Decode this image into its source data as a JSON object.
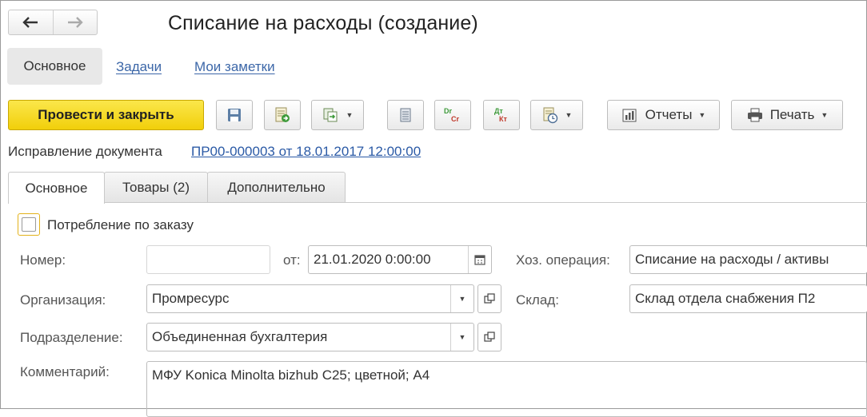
{
  "window": {
    "title": "Списание на расходы (создание)",
    "nav": {
      "back_icon": "arrow-left-icon",
      "forward_icon": "arrow-right-icon"
    }
  },
  "top_tabs": [
    {
      "label": "Основное",
      "active": true
    },
    {
      "label": "Задачи",
      "active": false
    },
    {
      "label": "Мои заметки",
      "active": false
    }
  ],
  "toolbar": {
    "post_and_close": "Провести и закрыть",
    "reports": "Отчеты",
    "print": "Печать",
    "dr_label": "Dr",
    "cr_label": "Cr",
    "dt_label": "Дт",
    "kt_label": "Кт",
    "accent": "#f5d70f"
  },
  "correction": {
    "label": "Исправление документа",
    "link": "ПР00-000003 от 18.01.2017 12:00:00"
  },
  "tabs": [
    {
      "label": "Основное",
      "active": true
    },
    {
      "label": "Товары (2)",
      "active": false
    },
    {
      "label": "Дополнительно",
      "active": false
    }
  ],
  "form": {
    "consumption_by_order": {
      "label": "Потребление по заказу",
      "checked": false
    },
    "number": {
      "label": "Номер:",
      "value": ""
    },
    "date": {
      "label": "от:",
      "value": "21.01.2020  0:00:00"
    },
    "operation": {
      "label": "Хоз. операция:",
      "value": "Списание на расходы / активы"
    },
    "organization": {
      "label": "Организация:",
      "value": "Промресурс"
    },
    "warehouse": {
      "label": "Склад:",
      "value": "Склад отдела снабжения П2"
    },
    "department": {
      "label": "Подразделение:",
      "value": "Объединенная бухгалтерия"
    },
    "comment": {
      "label": "Комментарий:",
      "value": "МФУ Konica Minolta bizhub C25; цветной; А4"
    }
  }
}
